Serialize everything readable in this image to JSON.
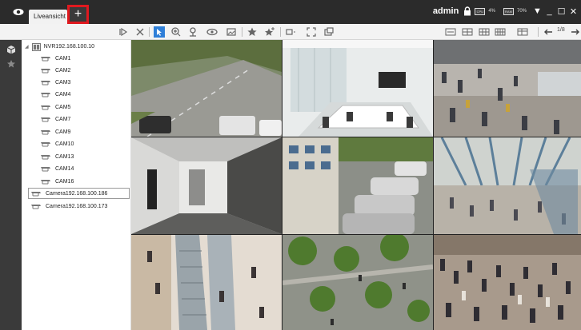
{
  "titlebar": {
    "tab_label": "Liveansicht",
    "add_tab_label": "+",
    "user": "admin",
    "cpu": "4%",
    "mem": "70%",
    "highlight_color": "#e0191f"
  },
  "toolbar": {
    "page": "1/8",
    "accent": "#2f7fd8"
  },
  "tree": {
    "nvr": "NVR192.168.100.10",
    "cams": [
      "CAM1",
      "CAM2",
      "CAM3",
      "CAM4",
      "CAM5",
      "CAM7",
      "CAM9",
      "CAM10",
      "CAM13",
      "CAM14",
      "CAM16"
    ],
    "camera_1": "Camera192.168.100.186",
    "camera_2": "Camera192.168.100.173"
  },
  "grid": {
    "layout": "3x3",
    "views": [
      "street-view",
      "conference-room-view",
      "waiting-hall-view",
      "corridor-view",
      "parking-lot-view",
      "shopping-mall-atrium-view",
      "escalator-view",
      "plaza-view",
      "crowd-view"
    ]
  }
}
